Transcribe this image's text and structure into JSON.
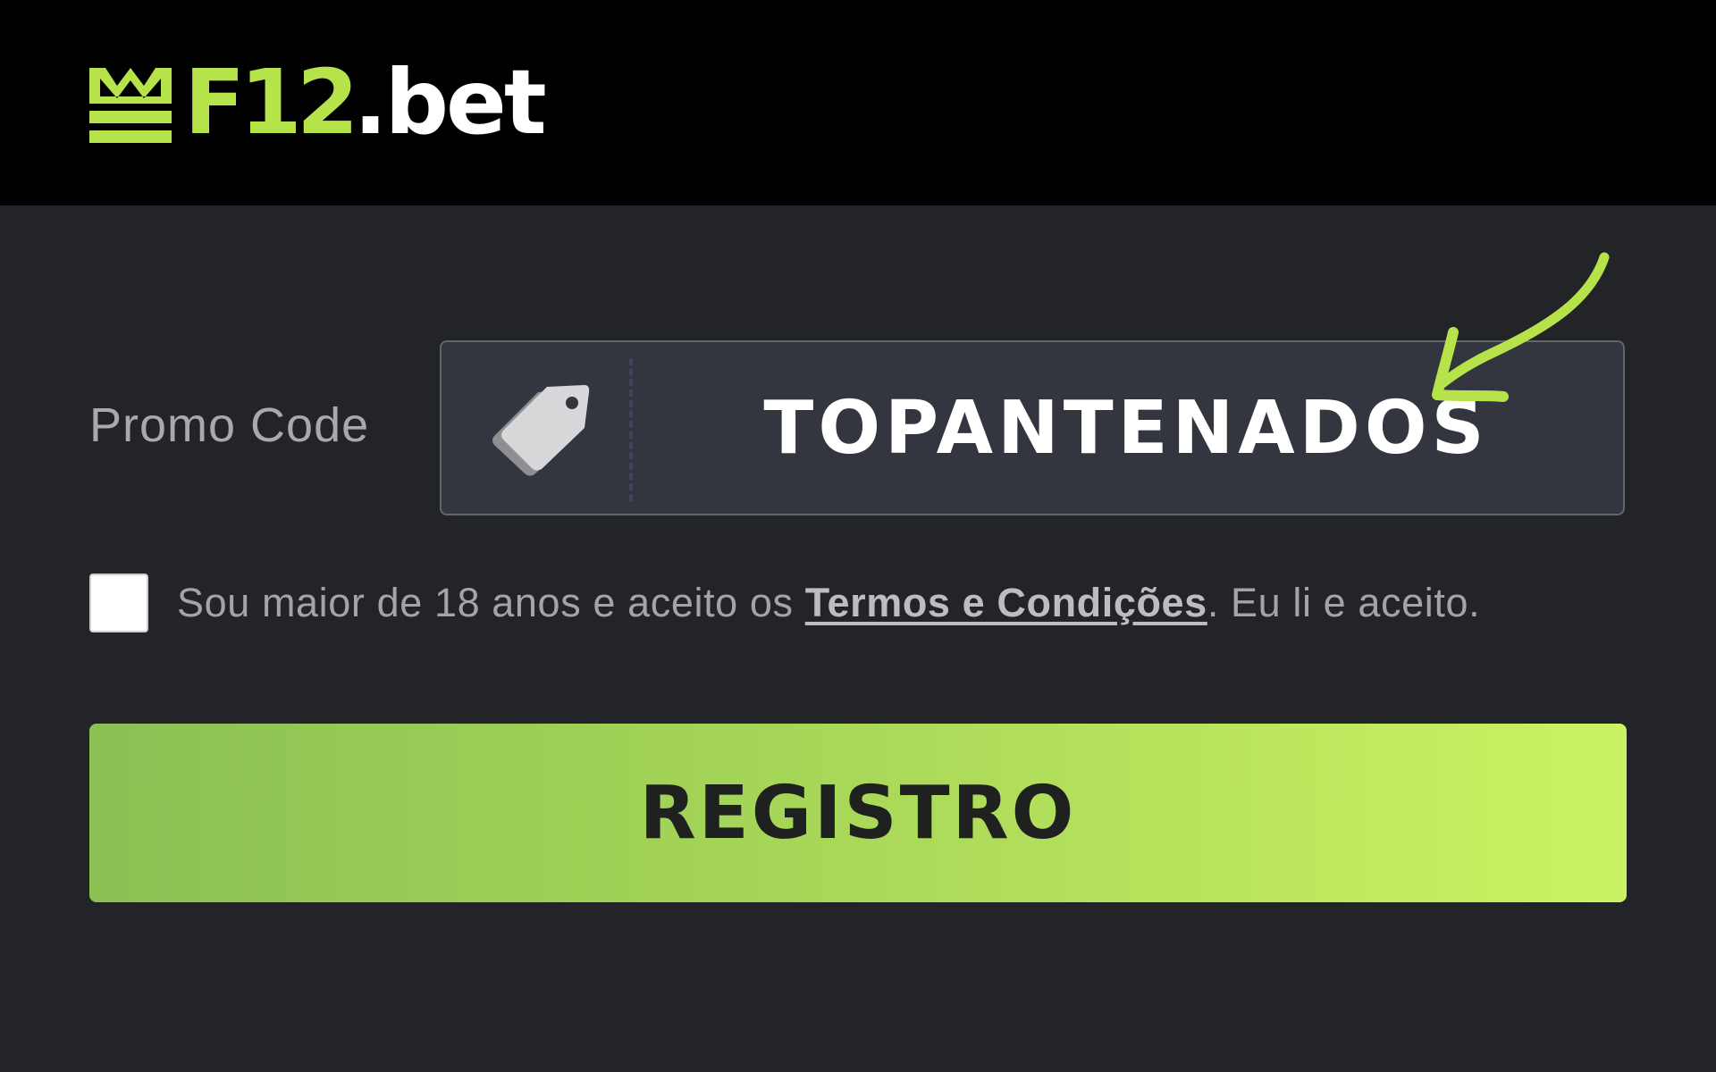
{
  "brand": {
    "logo_primary": "F12",
    "logo_secondary": ".bet",
    "accent_color": "#b7e34a"
  },
  "form": {
    "promo_label": "Promo Code",
    "promo_value": "TOPANTENADOS",
    "promo_icon": "price-tag-icon",
    "terms_prefix": "Sou maior de 18 anos e aceito os ",
    "terms_link": "Termos e Condições",
    "terms_suffix": ". Eu li e aceito.",
    "terms_checked": false,
    "submit_label": "REGISTRO"
  },
  "annotation": {
    "arrow_color": "#b7e34a"
  }
}
